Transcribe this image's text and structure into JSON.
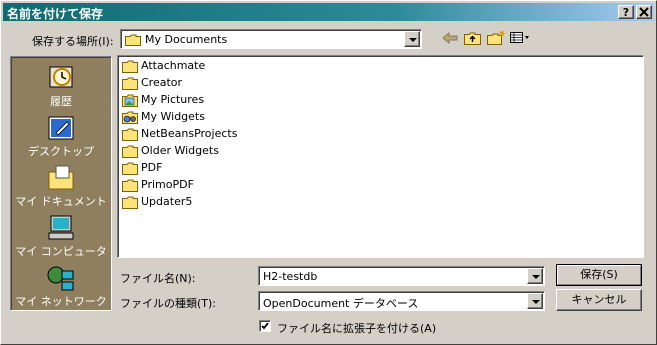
{
  "title": "名前を付けて保存",
  "title_buttons": {
    "help": "?",
    "close": "X"
  },
  "lookin": {
    "label": "保存する場所(I):",
    "value": "My Documents"
  },
  "toolbar": {
    "icons": [
      "back-arrow-icon",
      "up-folder-icon",
      "new-folder-icon",
      "view-menu-icon"
    ]
  },
  "places": [
    {
      "label": "履歴",
      "icon": "history-icon"
    },
    {
      "label": "デスクトップ",
      "icon": "desktop-icon"
    },
    {
      "label": "マイ ドキュメント",
      "icon": "my-documents-icon"
    },
    {
      "label": "マイ コンピュータ",
      "icon": "my-computer-icon"
    },
    {
      "label": "マイ ネットワーク",
      "icon": "my-network-icon"
    }
  ],
  "files": [
    {
      "name": "Attachmate",
      "icon": "folder-icon"
    },
    {
      "name": "Creator",
      "icon": "folder-icon"
    },
    {
      "name": "My Pictures",
      "icon": "pictures-folder-icon"
    },
    {
      "name": "My Widgets",
      "icon": "widgets-folder-icon"
    },
    {
      "name": "NetBeansProjects",
      "icon": "folder-icon"
    },
    {
      "name": "Older Widgets",
      "icon": "folder-icon"
    },
    {
      "name": "PDF",
      "icon": "folder-icon"
    },
    {
      "name": "PrimoPDF",
      "icon": "folder-icon"
    },
    {
      "name": "Updater5",
      "icon": "folder-icon"
    }
  ],
  "filename": {
    "label": "ファイル名(N):",
    "value": "H2-testdb"
  },
  "filetype": {
    "label": "ファイルの種類(T):",
    "value": "OpenDocument データベース"
  },
  "buttons": {
    "save": "保存(S)",
    "cancel": "キャンセル"
  },
  "extension_checkbox": {
    "label": "ファイル名に拡張子を付ける(A)",
    "checked": true
  }
}
